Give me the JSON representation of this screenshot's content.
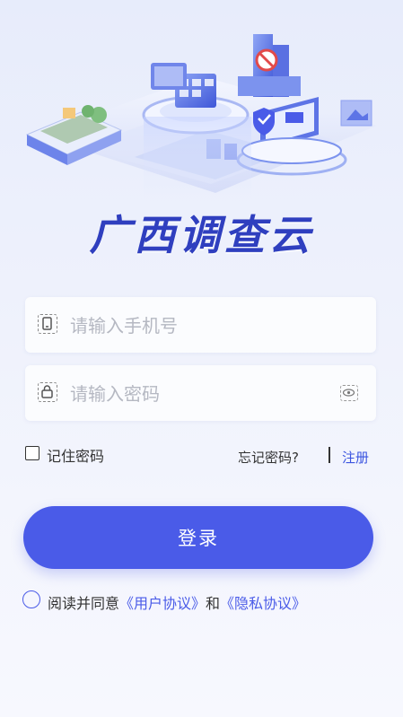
{
  "app": {
    "title": "广西调查云"
  },
  "login": {
    "phone_placeholder": "请输入手机号",
    "password_placeholder": "请输入密码",
    "remember_label": "记住密码",
    "forgot_label": "忘记密码?",
    "register_label": "注册",
    "login_button": "登录"
  },
  "agreement": {
    "prefix": "阅读并同意",
    "user_agreement": "《用户协议》",
    "and": "和",
    "privacy_policy": "《隐私协议》"
  },
  "colors": {
    "primary": "#4a5be8",
    "title": "#2f3fbf",
    "link": "#3b54e0"
  },
  "icons": {
    "phone_field": "phone-icon",
    "password_field": "lock-icon",
    "password_toggle": "eye-icon"
  }
}
